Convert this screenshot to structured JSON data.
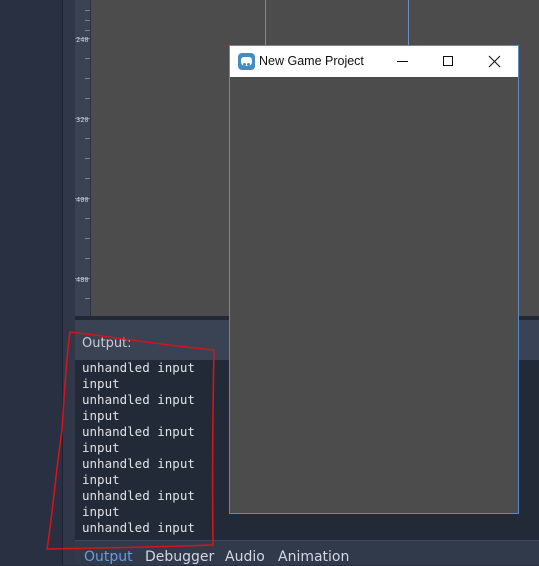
{
  "ruler": {
    "labels": [
      "240",
      "320",
      "400",
      "480"
    ]
  },
  "output_panel": {
    "label": "Output:",
    "log_text": "unhandled input\ninput\nunhandled input\ninput\nunhandled input\ninput\nunhandled input\ninput\nunhandled input\ninput\nunhandled input"
  },
  "bottom_tabs": [
    {
      "label": "Output",
      "active": true
    },
    {
      "label": "Debugger",
      "active": false
    },
    {
      "label": "Audio",
      "active": false
    },
    {
      "label": "Animation",
      "active": false
    }
  ],
  "game_window": {
    "title": "New Game Project",
    "icon": "godot-icon",
    "controls": [
      "minimize-icon",
      "maximize-icon",
      "close-icon"
    ]
  },
  "colors": {
    "accent": "#6a9ae8",
    "annotation": "#d4141c",
    "viewport": "#4c4c4c",
    "window_border": "#5a8ac4"
  }
}
